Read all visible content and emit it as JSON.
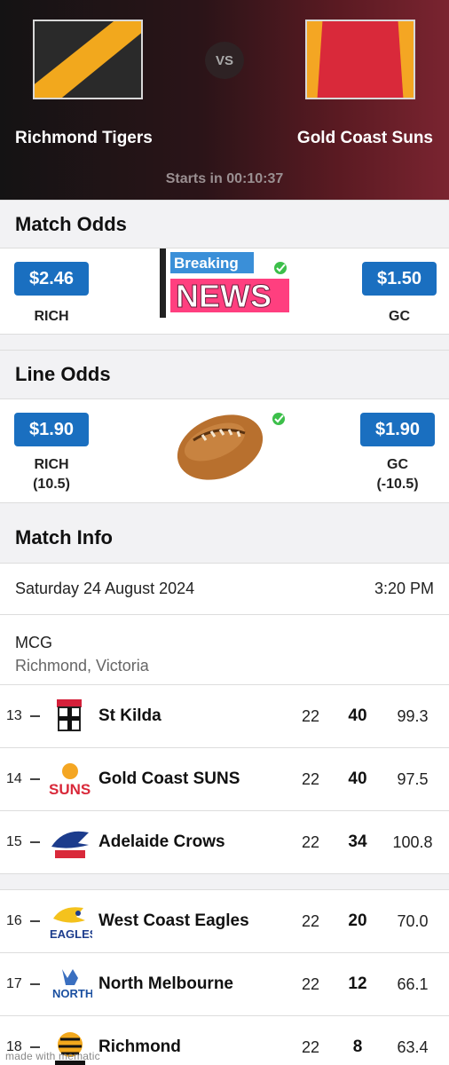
{
  "match": {
    "home_team": "Richmond Tigers",
    "away_team": "Gold Coast Suns",
    "vs_label": "VS",
    "countdown": "Starts in 00:10:37"
  },
  "match_odds": {
    "title": "Match Odds",
    "home_price": "$2.46",
    "home_label": "RICH",
    "away_price": "$1.50",
    "away_label": "GC"
  },
  "line_odds": {
    "title": "Line Odds",
    "home_price": "$1.90",
    "home_label": "RICH",
    "home_line": "(10.5)",
    "away_price": "$1.90",
    "away_label": "GC",
    "away_line": "(-10.5)"
  },
  "sticker": {
    "top_text": "Breaking",
    "main_text": "NEWS"
  },
  "match_info": {
    "title": "Match Info",
    "date": "Saturday 24 August 2024",
    "time": "3:20 PM",
    "venue": "MCG",
    "location": "Richmond, Victoria"
  },
  "ladder": [
    {
      "rank": "13",
      "team": "St Kilda",
      "played": "22",
      "points": "40",
      "percentage": "99.3"
    },
    {
      "rank": "14",
      "team": "Gold Coast SUNS",
      "played": "22",
      "points": "40",
      "percentage": "97.5"
    },
    {
      "rank": "15",
      "team": "Adelaide Crows",
      "played": "22",
      "points": "34",
      "percentage": "100.8"
    },
    {
      "rank": "16",
      "team": "West Coast Eagles",
      "played": "22",
      "points": "20",
      "percentage": "70.0"
    },
    {
      "rank": "17",
      "team": "North Melbourne",
      "played": "22",
      "points": "12",
      "percentage": "66.1"
    },
    {
      "rank": "18",
      "team": "Richmond",
      "played": "22",
      "points": "8",
      "percentage": "63.4"
    }
  ],
  "watermark": "made with mematic",
  "colors": {
    "price_button": "#1a6fc0",
    "richmond_yellow": "#f2a81d",
    "gold_coast_red": "#d9293a",
    "gold_coast_gold": "#f4a623"
  }
}
